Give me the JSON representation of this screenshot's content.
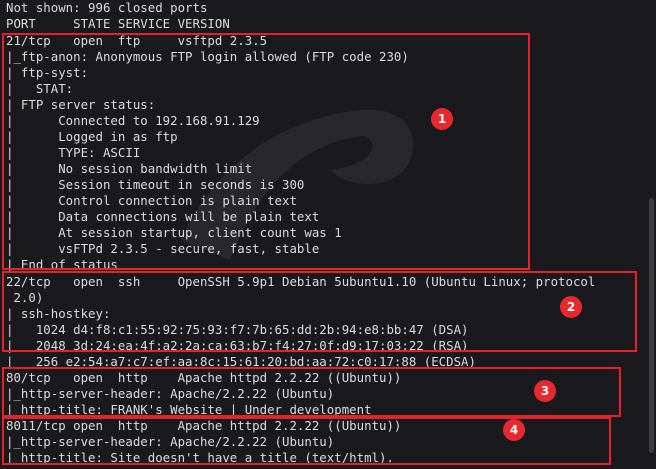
{
  "terminal": {
    "lines": [
      "Not shown: 996 closed ports",
      "PORT     STATE SERVICE VERSION",
      "21/tcp   open  ftp     vsftpd 2.3.5",
      "|_ftp-anon: Anonymous FTP login allowed (FTP code 230)",
      "| ftp-syst:",
      "|   STAT:",
      "| FTP server status:",
      "|      Connected to 192.168.91.129",
      "|      Logged in as ftp",
      "|      TYPE: ASCII",
      "|      No session bandwidth limit",
      "|      Session timeout in seconds is 300",
      "|      Control connection is plain text",
      "|      Data connections will be plain text",
      "|      At session startup, client count was 1",
      "|      vsFTPd 2.3.5 - secure, fast, stable",
      "|_End of status",
      "22/tcp   open  ssh     OpenSSH 5.9p1 Debian 5ubuntu1.10 (Ubuntu Linux; protocol",
      " 2.0)",
      "| ssh-hostkey:",
      "|   1024 d4:f8:c1:55:92:75:93:f7:7b:65:dd:2b:94:e8:bb:47 (DSA)",
      "|   2048 3d:24:ea:4f:a2:2a:ca:63:b7:f4:27:0f:d9:17:03:22 (RSA)",
      "|_  256 e2:54:a7:c7:ef:aa:8c:15:61:20:bd:aa:72:c0:17:88 (ECDSA)",
      "80/tcp   open  http    Apache httpd 2.2.22 ((Ubuntu))",
      "|_http-server-header: Apache/2.2.22 (Ubuntu)",
      "|_http-title: FRANK's Website | Under development",
      "8011/tcp open  http    Apache httpd 2.2.22 ((Ubuntu))",
      "|_http-server-header: Apache/2.2.22 (Ubuntu)",
      "|_http-title: Site doesn't have a title (text/html)."
    ]
  },
  "annotations": {
    "color": "#e8202a",
    "badges": [
      "1",
      "2",
      "3",
      "4"
    ]
  }
}
